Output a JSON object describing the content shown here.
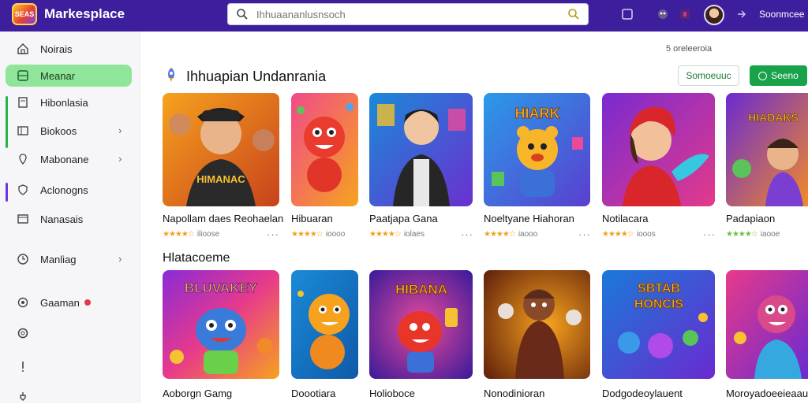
{
  "header": {
    "logo_text": "SEAS",
    "brand": "Markesplace",
    "search_placeholder": "Ihhuaananlusnsoch",
    "user_label": "Soonmcee",
    "colors": {
      "bar": "#3d1f9e",
      "accent_green": "#18a24a",
      "active_green": "#8fe59a"
    }
  },
  "sidebar": {
    "items": [
      {
        "label": "Noirais",
        "icon": "home-icon"
      },
      {
        "label": "Meanar",
        "icon": "grid-icon",
        "active": true
      },
      {
        "label": "Hibonlasia",
        "icon": "book-icon"
      },
      {
        "label": "Biokoos",
        "icon": "sidebar-icon",
        "chevron": true
      },
      {
        "label": "Mabonane",
        "icon": "pin-icon",
        "chevron": true
      },
      {
        "label": "Aclonogns",
        "icon": "shield-icon"
      },
      {
        "label": "Nanasais",
        "icon": "window-icon"
      },
      {
        "label": "Manliag",
        "icon": "clock-icon",
        "chevron": true
      },
      {
        "label": "Gaaman",
        "icon": "settings-icon",
        "badge": true
      },
      {
        "label": "",
        "icon": "circle-icon"
      },
      {
        "label": "",
        "icon": "alert-icon"
      },
      {
        "label": "",
        "icon": "plug-icon"
      }
    ]
  },
  "main": {
    "top_status": "5 oreleeroia",
    "section1": {
      "title": "Ihhuapian Undanrania",
      "btn_secondary": "Somoeuuc",
      "btn_primary": "Seeno"
    },
    "section2": {
      "title": "Hlatacoeme"
    },
    "row1": [
      {
        "title": "Napollam daes Reohaelan",
        "meta": "ilioose",
        "stars": "★★★★☆",
        "art": "HIMANAC"
      },
      {
        "title": "Hibuaran",
        "meta": "ioooo",
        "stars": "★★★★☆",
        "art": ""
      },
      {
        "title": "Paatjapa Gana",
        "meta": "iolaes",
        "stars": "★★★★☆",
        "art": ""
      },
      {
        "title": "Noeltyane Hiahoran",
        "meta": "iaooo",
        "stars": "★★★★☆",
        "art": "HIARK"
      },
      {
        "title": "Notilacara",
        "meta": "iooos",
        "stars": "★★★★☆",
        "art": ""
      },
      {
        "title": "Padapiaon",
        "meta": "iaooe",
        "stars": "★★★★☆",
        "art": "HIADAKS"
      }
    ],
    "row2": [
      {
        "title": "Aoborgn Gamg",
        "art": "BLUVAKEY"
      },
      {
        "title": "Doootiara",
        "art": ""
      },
      {
        "title": "Holioboce",
        "art": "HIBANA"
      },
      {
        "title": "Nonodinioran",
        "art": ""
      },
      {
        "title": "Dodgodeoylauent",
        "art": "SBTAB HONCIS"
      },
      {
        "title": "Moroyadoeeieaauc",
        "art": ""
      }
    ]
  }
}
